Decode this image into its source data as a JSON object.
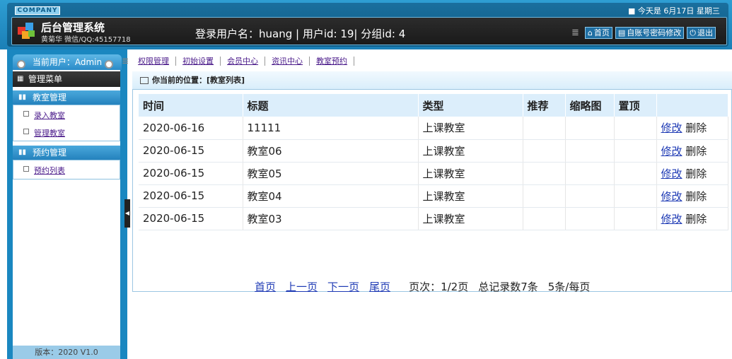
{
  "header": {
    "company": "COMPANY",
    "system_title": "后台管理系统",
    "author": "黄菊华 微信/QQ:45157718",
    "login_info": "登录用户名：huang | 用户id: 19| 分组id: 4",
    "date": "■ 今天是 6月17日 星期三",
    "buttons": [
      {
        "label": "首页",
        "icon": "home-icon"
      },
      {
        "label": "自账号密码修改",
        "icon": "book-icon"
      },
      {
        "label": "退出",
        "icon": "power-icon"
      }
    ]
  },
  "sidebar": {
    "current_user": "当前用户：Admin",
    "menu_title": "管理菜单",
    "sections": [
      {
        "title": "教室管理",
        "items": [
          "录入教室",
          "管理教室"
        ]
      },
      {
        "title": "预约管理",
        "items": [
          "预约列表"
        ]
      }
    ],
    "version": "版本：2020 V1.0"
  },
  "topnav": [
    "权限管理",
    "初始设置",
    "会员中心",
    "资讯中心",
    "教室预约"
  ],
  "location": "你当前的位置：[教室列表]",
  "table": {
    "headers": [
      "时间",
      "标题",
      "类型",
      "推荐",
      "缩略图",
      "置顶",
      ""
    ],
    "rows": [
      {
        "time": "2020-06-16",
        "title": "11111",
        "type": "上课教室",
        "edit": "修改",
        "del": "删除"
      },
      {
        "time": "2020-06-15",
        "title": "教室06",
        "type": "上课教室",
        "edit": "修改",
        "del": "删除"
      },
      {
        "time": "2020-06-15",
        "title": "教室05",
        "type": "上课教室",
        "edit": "修改",
        "del": "删除"
      },
      {
        "time": "2020-06-15",
        "title": "教室04",
        "type": "上课教室",
        "edit": "修改",
        "del": "删除"
      },
      {
        "time": "2020-06-15",
        "title": "教室03",
        "type": "上课教室",
        "edit": "修改",
        "del": "删除"
      }
    ]
  },
  "pager": {
    "first": "首页",
    "prev": "上一页",
    "next": "下一页",
    "last": "尾页",
    "info1": "页次：1/2页",
    "info2": "总记录数7条",
    "info3": "5条/每页"
  }
}
